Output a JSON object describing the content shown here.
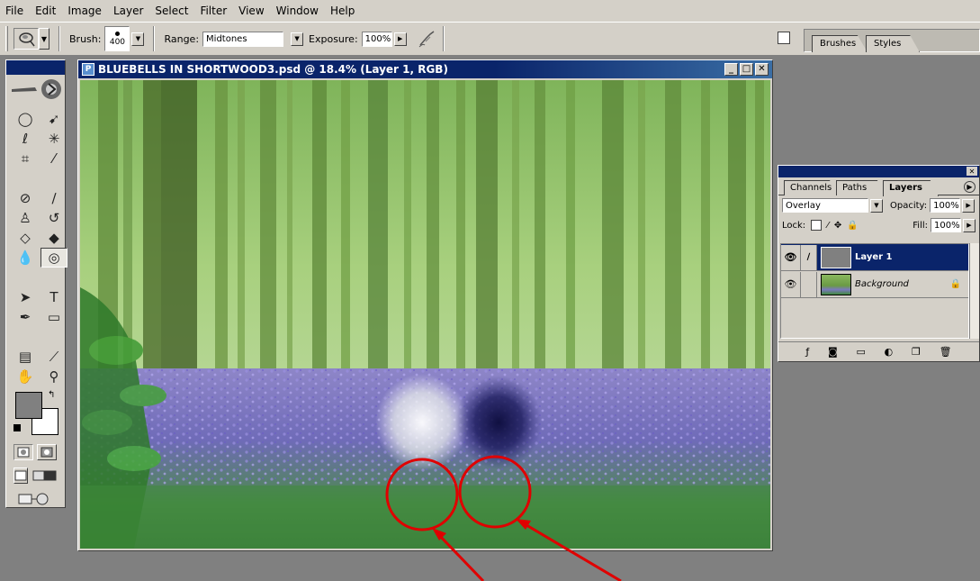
{
  "menu": [
    "File",
    "Edit",
    "Image",
    "Layer",
    "Select",
    "Filter",
    "View",
    "Window",
    "Help"
  ],
  "options_bar": {
    "brush_label": "Brush:",
    "brush_size": "400",
    "range_label": "Range:",
    "range_value": "Midtones",
    "exposure_label": "Exposure:",
    "exposure_value": "100%"
  },
  "palette_well": {
    "tabs": [
      "Brushes",
      "Styles"
    ]
  },
  "document": {
    "title": "BLUEBELLS IN SHORTWOOD3.psd @ 18.4% (Layer 1, RGB)"
  },
  "layers_panel": {
    "tabs": [
      "Channels",
      "Paths",
      "Layers"
    ],
    "active_tab": "Layers",
    "blend_mode": "Overlay",
    "opacity_label": "Opacity:",
    "opacity_value": "100%",
    "lock_label": "Lock:",
    "fill_label": "Fill:",
    "fill_value": "100%",
    "layers": [
      {
        "name": "Layer 1",
        "selected": true
      },
      {
        "name": "Background",
        "selected": false,
        "locked": true
      }
    ]
  },
  "colors": {
    "foreground": "#808080",
    "background": "#ffffff",
    "annotation": "#e00000"
  }
}
